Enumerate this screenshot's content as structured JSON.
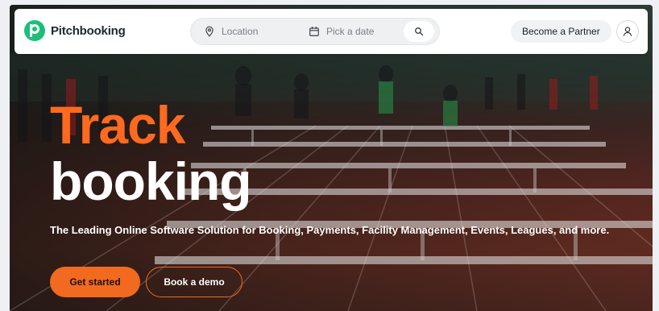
{
  "brand": {
    "name": "Pitchbooking",
    "logo_icon": "pitchbooking-logo-icon",
    "color": "#1cbf7a"
  },
  "search": {
    "location_placeholder": "Location",
    "location_icon": "map-pin-icon",
    "date_placeholder": "Pick a date",
    "date_icon": "calendar-icon",
    "button_icon": "search-icon"
  },
  "header": {
    "partner_label": "Become a Partner",
    "account_icon": "user-icon"
  },
  "hero": {
    "title_accent": "Track",
    "title_main": "booking",
    "subtitle": "The Leading Online Software Solution for Booking, Payments, Facility Management, Events, Leagues, and more.",
    "accent_color": "#ff6a1f",
    "primary_cta": "Get started",
    "secondary_cta": "Book a demo"
  }
}
